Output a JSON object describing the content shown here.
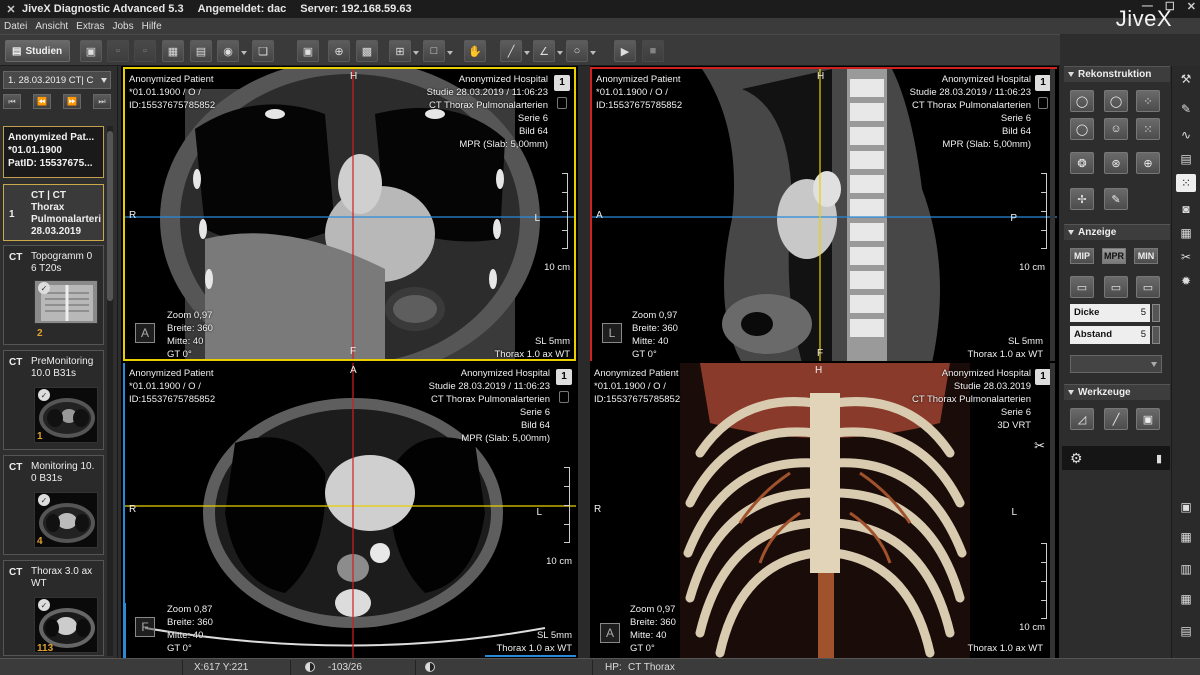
{
  "title_bar": {
    "app_title": "JiveX Diagnostic Advanced 5.3",
    "logged_in": "Angemeldet: dac",
    "server": "Server: 192.168.59.63"
  },
  "menu": [
    "Datei",
    "Ansicht",
    "Extras",
    "Jobs",
    "Hilfe"
  ],
  "brand": "JiveX",
  "toolbar": {
    "studien_label": "Studien"
  },
  "left_panel": {
    "study_selector": "1. 28.03.2019 CT| C",
    "patient": {
      "name": "Anonymized Pat...",
      "dob": "*01.01.1900",
      "pat_id": "PatID: 15537675..."
    },
    "series": [
      {
        "idx": "1",
        "lines": [
          "CT | CT",
          "Thorax",
          "Pulmonalarteri",
          "28.03.2019"
        ],
        "selected": true
      },
      {
        "idx": "CT",
        "lines": [
          "Topogramm 0",
          "6 T20s"
        ],
        "count": "2"
      },
      {
        "idx": "CT",
        "lines": [
          "PreMonitoring",
          "10.0 B31s"
        ],
        "count": "1"
      },
      {
        "idx": "CT",
        "lines": [
          "Monitoring 10.",
          "0 B31s"
        ],
        "count": "4"
      },
      {
        "idx": "CT",
        "lines": [
          "Thorax 3.0 ax",
          "WT"
        ],
        "count": "113"
      }
    ]
  },
  "viewports": [
    {
      "id": "coronal",
      "top_left": [
        "Anonymized Patient",
        "*01.01.1900 / O /",
        "ID:15537675785852"
      ],
      "top_right": [
        "Anonymized Hospital",
        "Studie 28.03.2019 / 11:06:23",
        "CT Thorax Pulmonalarterien",
        "Serie 6",
        "Bild 64",
        "MPR (Slab: 5,00mm)"
      ],
      "bottom_left": [
        "Zoom 0,97",
        "Breite: 360",
        "Mitte: 40",
        "GT 0°"
      ],
      "bottom_right": [
        "SL 5mm",
        "Thorax  1.0 ax WT"
      ],
      "number": "1",
      "orient_top": "H",
      "orient_bottom": "F",
      "orient_left": "R",
      "orient_right": "L",
      "orient_badge": "A",
      "scale_label": "10 cm"
    },
    {
      "id": "sagittal",
      "top_left": [
        "Anonymized Patient",
        "*01.01.1900 / O /",
        "ID:15537675785852"
      ],
      "top_right": [
        "Anonymized Hospital",
        "Studie 28.03.2019 / 11:06:23",
        "CT Thorax Pulmonalarterien",
        "Serie 6",
        "Bild 64",
        "MPR (Slab: 5,00mm)"
      ],
      "bottom_left": [
        "Zoom 0,97",
        "Breite: 360",
        "Mitte: 40",
        "GT 0°"
      ],
      "bottom_right": [
        "SL 5mm",
        "Thorax  1.0 ax WT"
      ],
      "number": "1",
      "orient_top": "H",
      "orient_bottom": "F",
      "orient_left": "A",
      "orient_right": "P",
      "orient_badge": "L",
      "scale_label": "10 cm"
    },
    {
      "id": "axial",
      "top_left": [
        "Anonymized Patient",
        "*01.01.1900 / O /",
        "ID:15537675785852"
      ],
      "top_right": [
        "Anonymized Hospital",
        "Studie 28.03.2019 / 11:06:23",
        "CT Thorax Pulmonalarterien",
        "Serie 6",
        "Bild 64",
        "MPR (Slab: 5,00mm)"
      ],
      "bottom_left": [
        "Zoom 0,87",
        "Breite: 360",
        "Mitte: 40",
        "GT 0°"
      ],
      "bottom_right": [
        "SL 5mm",
        "Thorax  1.0 ax WT"
      ],
      "number": "1",
      "orient_top": "A",
      "orient_bottom": "",
      "orient_left": "R",
      "orient_right": "L",
      "orient_badge": "F",
      "scale_label": "10 cm"
    },
    {
      "id": "vrt",
      "top_left": [
        "Anonymized Patient",
        "*01.01.1900 / O /",
        "ID:15537675785852"
      ],
      "top_right": [
        "Anonymized Hospital",
        "Studie 28.03.2019",
        "CT Thorax Pulmonalarterien",
        "Serie 6",
        "3D VRT"
      ],
      "bottom_left": [
        "Zoom 0,97",
        "Breite: 360",
        "Mitte: 40",
        "GT 0°"
      ],
      "bottom_right": [
        "Thorax  1.0 ax WT"
      ],
      "number": "1",
      "orient_top": "H",
      "orient_bottom": "",
      "orient_left": "R",
      "orient_right": "L",
      "orient_badge": "A",
      "scale_label": "10 cm"
    }
  ],
  "right_panel": {
    "rekonstruktion": "Rekonstruktion",
    "anzeige": "Anzeige",
    "modes": [
      "MIP",
      "MPR",
      "MIN"
    ],
    "active_mode": "MPR",
    "dicke_label": "Dicke",
    "dicke_value": "5",
    "abstand_label": "Abstand",
    "abstand_value": "5",
    "werkzeuge": "Werkzeuge"
  },
  "status_bar": {
    "coords": "X:617 Y:221",
    "value": "-103/26",
    "hp_label": "HP:",
    "hp_value": "CT Thorax"
  },
  "colors": {
    "accent_yellow": "#e8d000",
    "accent_red": "#d02020",
    "accent_blue": "#2a8ad8"
  }
}
